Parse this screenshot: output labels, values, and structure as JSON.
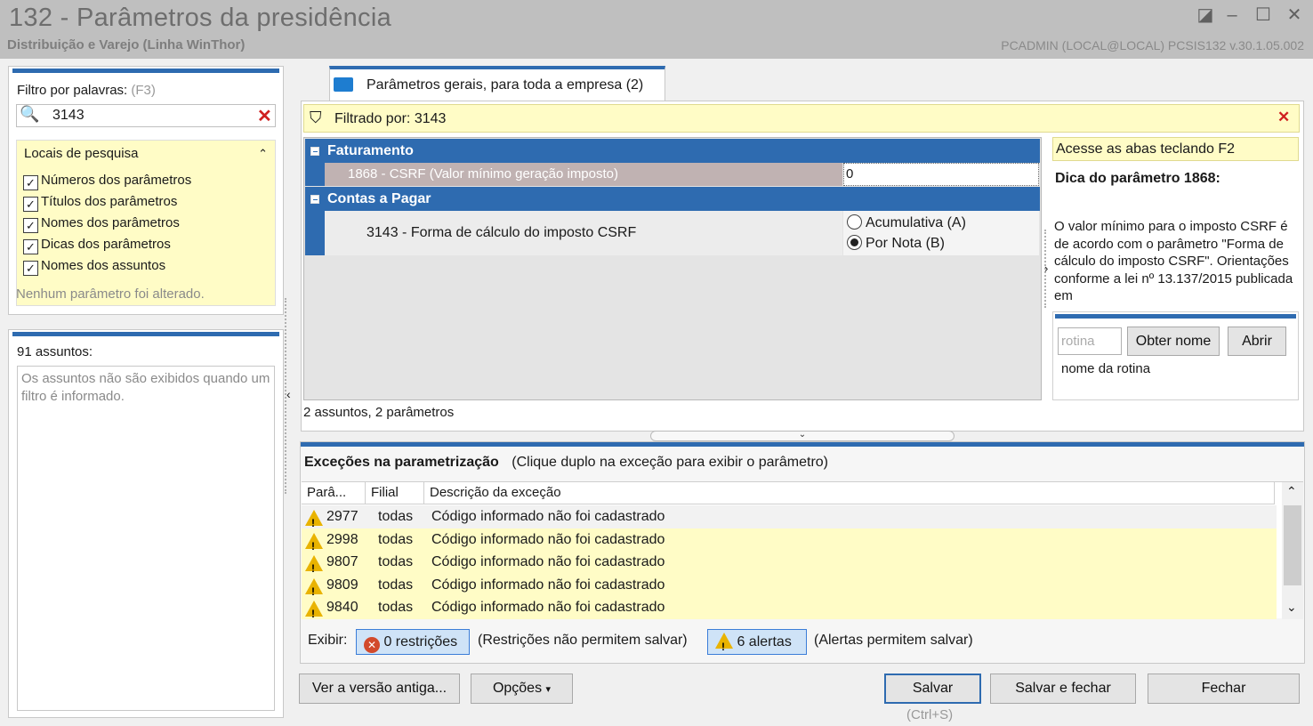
{
  "window": {
    "title": "132 - Parâmetros da presidência",
    "subtitle": "Distribuição e Varejo (Linha WinThor)",
    "user_info": "PCADMIN (LOCAL@LOCAL)   PCSIS132  v.30.1.05.002"
  },
  "left": {
    "filter_label": "Filtro por palavras:",
    "filter_shortcut": "(F3)",
    "search_value": "3143",
    "locations_title": "Locais de pesquisa",
    "locations": [
      {
        "label": "Números dos parâmetros",
        "checked": true
      },
      {
        "label": "Títulos dos parâmetros",
        "checked": true
      },
      {
        "label": "Nomes dos parâmetros",
        "checked": true
      },
      {
        "label": "Dicas dos parâmetros",
        "checked": true
      },
      {
        "label": "Nomes dos assuntos",
        "checked": true
      }
    ],
    "status": "Nenhum parâmetro foi alterado.",
    "subjects_count": "91 assuntos:",
    "subjects_note": "Os assuntos não são exibidos quando um filtro é informado."
  },
  "tab": {
    "label": "Parâmetros gerais, para toda a empresa  (2)"
  },
  "filter_bar": {
    "text": "Filtrado por: 3143"
  },
  "grid": {
    "groups": [
      {
        "name": "Faturamento",
        "param_label": "1868 - CSRF (Valor mínimo geração imposto)",
        "param_value": "0"
      },
      {
        "name": "Contas a Pagar",
        "param_label": "3143 - Forma de cálculo do imposto CSRF",
        "options": [
          "Acumulativa (A)",
          "Por Nota (B)"
        ],
        "selected": "Por Nota (B)"
      }
    ],
    "summary": "2 assuntos, 2 parâmetros"
  },
  "hint": {
    "header": "Acesse as abas teclando F2",
    "title": "Dica do parâmetro 1868:",
    "body": "O valor mínimo para o imposto CSRF é de acordo com o parâmetro \"Forma de cálculo do imposto CSRF\". Orientações conforme a lei nº 13.137/2015 publicada em",
    "routine_placeholder": "rotina",
    "get_name_button": "Obter nome",
    "open_button": "Abrir",
    "routine_name_label": "nome da rotina"
  },
  "exceptions": {
    "title": "Exceções na parametrização",
    "subtitle": "(Clique duplo na exceção para exibir o parâmetro)",
    "columns": [
      "Parâ...",
      "Filial",
      "Descrição da exceção"
    ],
    "rows": [
      {
        "param": "2977",
        "branch": "todas",
        "description": "Código informado não foi cadastrado"
      },
      {
        "param": "2998",
        "branch": "todas",
        "description": "Código informado não foi cadastrado"
      },
      {
        "param": "9807",
        "branch": "todas",
        "description": "Código informado não foi cadastrado"
      },
      {
        "param": "9809",
        "branch": "todas",
        "description": "Código informado não foi cadastrado"
      },
      {
        "param": "9840",
        "branch": "todas",
        "description": "Código informado não foi cadastrado"
      }
    ],
    "show_label": "Exibir:",
    "restrictions_button": "0 restrições",
    "restrictions_note": "(Restrições não permitem salvar)",
    "alerts_button": "6 alertas",
    "alerts_note": "(Alertas permitem salvar)"
  },
  "footer": {
    "old_version_button": "Ver a versão antiga...",
    "options_button": "Opções",
    "save_button": "Salvar",
    "save_shortcut": "(Ctrl+S)",
    "save_close_button": "Salvar e fechar",
    "close_button": "Fechar"
  },
  "colors": {
    "accent": "#2e6bb0",
    "highlight_yellow": "#fffcc6",
    "selected_row": "#c0b2b2"
  }
}
